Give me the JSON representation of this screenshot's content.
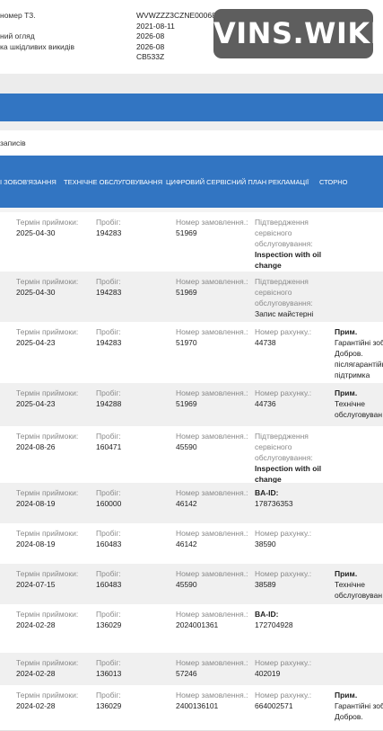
{
  "vehicle_info": {
    "rows": [
      {
        "label": "номер ТЗ.",
        "value": "WVWZZZ3CZNE000685"
      },
      {
        "label": "",
        "value": "2021-08-11"
      },
      {
        "label": "ний огляд",
        "value": "2026-08"
      },
      {
        "label": "ка шкідливих викидів",
        "value": "2026-08"
      },
      {
        "label": "",
        "value": "CB533Z"
      }
    ]
  },
  "logo": {
    "text": "VINS.WIKI"
  },
  "records_bar": {
    "label": "записів"
  },
  "tabs": [
    {
      "label": "І ЗОБОВ'ЯЗАННЯ"
    },
    {
      "label": "ТЕХНІЧНЕ ОБСЛУГОВУВАННЯ"
    },
    {
      "label": "ЦИФРОВИЙ СЕРВІСНИЙ ПЛАН"
    },
    {
      "label": "РЕКЛАМАЦІЇ"
    },
    {
      "label": "СТОРНО"
    }
  ],
  "labels": {
    "received": "Термін приймоки:",
    "mileage": "Пробіг:",
    "order_no": "Номер замовлення.:",
    "invoice_no": "Номер рахунку.:",
    "confirm": "Підтвердження сервісного обслуговування:",
    "ba_id": "BA-ID:",
    "note": "Прим."
  },
  "records": [
    {
      "date": "2025-04-30",
      "mileage": "194283",
      "order": "51969",
      "c4_type": "confirm",
      "c4_value": "Inspection with oil change",
      "note": ""
    },
    {
      "date": "2025-04-30",
      "mileage": "194283",
      "order": "51969",
      "c4_type": "confirm",
      "c4_value": "Запис майстерні",
      "note": ""
    },
    {
      "date": "2025-04-23",
      "mileage": "194283",
      "order": "51970",
      "c4_type": "invoice",
      "c4_value": "44738",
      "note": "Гарантійні зоб. Добров. післягарантійна підтримка"
    },
    {
      "date": "2025-04-23",
      "mileage": "194288",
      "order": "51969",
      "c4_type": "invoice",
      "c4_value": "44736",
      "note": "Технічне обслуговуван"
    },
    {
      "date": "2024-08-26",
      "mileage": "160471",
      "order": "45590",
      "c4_type": "confirm",
      "c4_value": "Inspection with oil change",
      "note": ""
    },
    {
      "date": "2024-08-19",
      "mileage": "160000",
      "order": "46142",
      "c4_type": "ba",
      "c4_value": "178736353",
      "note": ""
    },
    {
      "date": "2024-08-19",
      "mileage": "160483",
      "order": "46142",
      "c4_type": "invoice",
      "c4_value": "38590",
      "note": ""
    },
    {
      "date": "2024-07-15",
      "mileage": "160483",
      "order": "45590",
      "c4_type": "invoice",
      "c4_value": "38589",
      "note": "Технічне обслуговуван"
    },
    {
      "date": "2024-02-28",
      "mileage": "136029",
      "order": "2024001361",
      "c4_type": "ba",
      "c4_value": "172704928",
      "note": ""
    },
    {
      "date": "2024-02-28",
      "mileage": "136013",
      "order": "57246",
      "c4_type": "invoice",
      "c4_value": "402019",
      "note": ""
    },
    {
      "date": "2024-02-28",
      "mileage": "136029",
      "order": "2400136101",
      "c4_type": "invoice",
      "c4_value": "664002571",
      "note": "Гарантійні зоб. Добров."
    }
  ]
}
